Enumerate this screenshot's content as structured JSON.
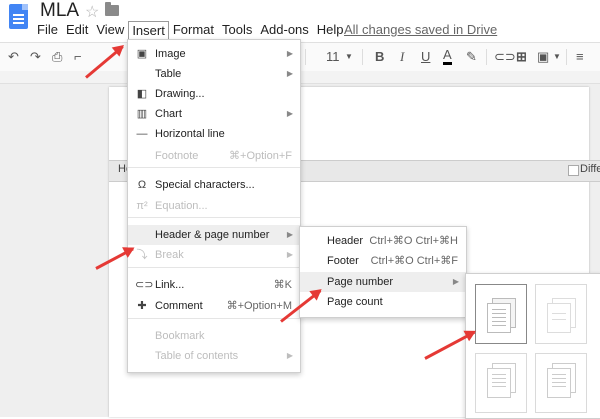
{
  "doc": {
    "title": "MLA",
    "save_status": "All changes saved in Drive"
  },
  "menubar": [
    "File",
    "Edit",
    "View",
    "Insert",
    "Format",
    "Tools",
    "Add-ons",
    "Help"
  ],
  "toolbar": {
    "font_size": "11",
    "bold": "B",
    "italic": "I",
    "underline": "U",
    "text_color": "A"
  },
  "header_strip": {
    "label": "He",
    "different_first_page": "Differ"
  },
  "insert_menu": {
    "items": [
      {
        "icon": "image-icon",
        "glyph": "▣",
        "label": "Image",
        "shortcut": "",
        "submenu": true,
        "disabled": false
      },
      {
        "icon": "",
        "glyph": "",
        "label": "Table",
        "shortcut": "",
        "submenu": true,
        "disabled": false
      },
      {
        "icon": "drawing-icon",
        "glyph": "◧",
        "label": "Drawing...",
        "shortcut": "",
        "submenu": false,
        "disabled": false
      },
      {
        "icon": "chart-icon",
        "glyph": "▥",
        "label": "Chart",
        "shortcut": "",
        "submenu": true,
        "disabled": false
      },
      {
        "icon": "horizontal-line-icon",
        "glyph": "—",
        "label": "Horizontal line",
        "shortcut": "",
        "submenu": false,
        "disabled": false
      },
      {
        "icon": "",
        "glyph": "",
        "label": "Footnote",
        "shortcut": "⌘+Option+F",
        "submenu": false,
        "disabled": true
      },
      {
        "icon": "omega-icon",
        "glyph": "Ω",
        "label": "Special characters...",
        "shortcut": "",
        "submenu": false,
        "disabled": false
      },
      {
        "icon": "pi-icon",
        "glyph": "π²",
        "label": "Equation...",
        "shortcut": "",
        "submenu": false,
        "disabled": true
      },
      {
        "icon": "",
        "glyph": "",
        "label": "Header & page number",
        "shortcut": "",
        "submenu": true,
        "disabled": false
      },
      {
        "icon": "page-break-icon",
        "glyph": "⤵",
        "label": "Break",
        "shortcut": "",
        "submenu": true,
        "disabled": true
      },
      {
        "icon": "link-icon",
        "glyph": "⊂⊃",
        "label": "Link...",
        "shortcut": "⌘K",
        "submenu": false,
        "disabled": false
      },
      {
        "icon": "comment-icon",
        "glyph": "✚",
        "label": "Comment",
        "shortcut": "⌘+Option+M",
        "submenu": false,
        "disabled": false
      },
      {
        "icon": "",
        "glyph": "",
        "label": "Bookmark",
        "shortcut": "",
        "submenu": false,
        "disabled": true
      },
      {
        "icon": "",
        "glyph": "",
        "label": "Table of contents",
        "shortcut": "",
        "submenu": true,
        "disabled": true
      }
    ]
  },
  "header_submenu": {
    "items": [
      {
        "label": "Header",
        "shortcut": "Ctrl+⌘O Ctrl+⌘H",
        "submenu": false
      },
      {
        "label": "Footer",
        "shortcut": "Ctrl+⌘O Ctrl+⌘F",
        "submenu": false
      },
      {
        "label": "Page number",
        "shortcut": "",
        "submenu": true
      },
      {
        "label": "Page count",
        "shortcut": "",
        "submenu": false
      }
    ]
  },
  "accent": {
    "annotation_arrow": "#e53935",
    "doc_blue": "#4285f4"
  }
}
